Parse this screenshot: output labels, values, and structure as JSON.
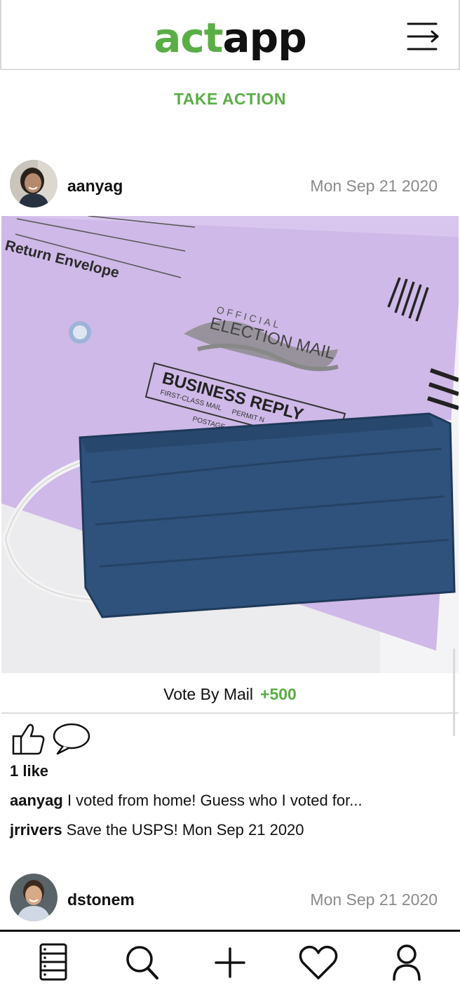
{
  "header": {
    "logo_part1": "act",
    "logo_part2": "app",
    "menu_icon": "menu-arrow-icon"
  },
  "take_action_label": "TAKE ACTION",
  "posts": [
    {
      "username": "aanyag",
      "date": "Mon Sep 21 2020",
      "image_alt": "Return envelope with official election mail and a blue cloth face mask",
      "image_text": {
        "envelope_label": "Return Envelope",
        "official": "OFFICIAL",
        "election_mail": "ELECTION MAIL",
        "business_reply": "BUSINESS REPLY",
        "first_class": "FIRST-CLASS MAIL",
        "permit": "PERMIT N",
        "postage": "POSTAGE"
      },
      "action_name": "Vote By Mail",
      "action_points": "+500",
      "likes": "1 like",
      "comments": [
        {
          "user": "aanyag",
          "text": "I voted from home! Guess who I voted for..."
        },
        {
          "user": "jrrivers",
          "text": "Save the USPS! Mon Sep 21 2020"
        }
      ]
    },
    {
      "username": "dstonem",
      "date": "Mon Sep 21 2020"
    }
  ],
  "bottom_nav": [
    {
      "icon": "feed-icon"
    },
    {
      "icon": "search-icon"
    },
    {
      "icon": "plus-icon"
    },
    {
      "icon": "heart-icon"
    },
    {
      "icon": "profile-icon"
    }
  ],
  "colors": {
    "brand_green": "#5aae46",
    "mask_blue": "#2f527c",
    "envelope_lavender": "#cfb9e8"
  }
}
